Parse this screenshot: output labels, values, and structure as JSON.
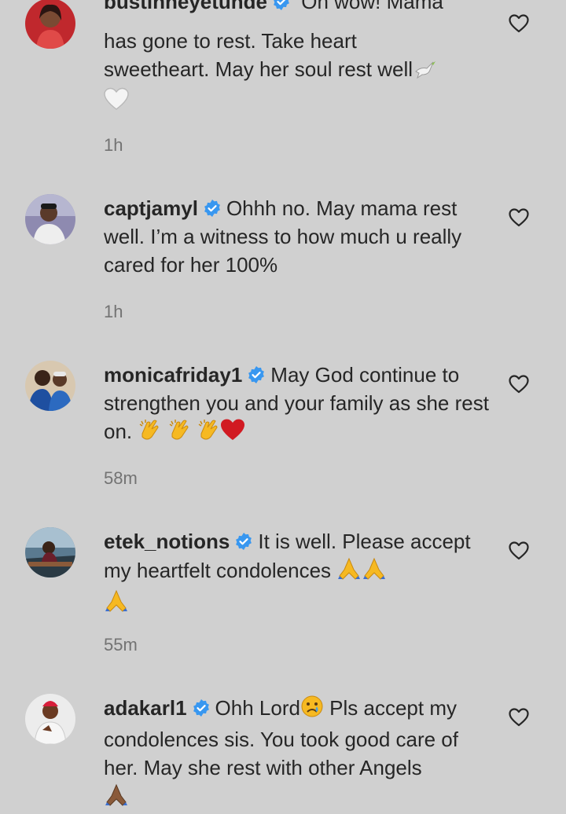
{
  "comments": [
    {
      "username": "bustinneyetunde",
      "text": "Oh wow! Mama has gone to rest. Take heart sweetheart. May her soul rest well",
      "emojis": [
        "dove",
        "white-heart"
      ],
      "time": "1h"
    },
    {
      "username": "captjamyl",
      "text": "Ohhh no. May mama rest well. I’m a witness to how much u really cared for her 100%",
      "emojis": [],
      "time": "1h"
    },
    {
      "username": "monicafriday1",
      "text": "May God continue to strengthen you and your family as she rest on.",
      "emojis": [
        "clapping-hands",
        "clapping-hands",
        "clapping-hands",
        "red-heart"
      ],
      "time": "58m"
    },
    {
      "username": "etek_notions",
      "text": "It is well. Please accept my heartfelt condolences",
      "emojis": [
        "folded-hands",
        "folded-hands",
        "folded-hands"
      ],
      "time": "55m"
    },
    {
      "username": "adakarl1",
      "text_before_emoji": "Ohh Lord",
      "text": "Pls accept my condolences sis. You took good care of her. May she rest with other Angels",
      "emojis": [
        "sad-face",
        "folded-hands-dark"
      ],
      "time": ""
    }
  ],
  "colors": {
    "background": "#d0d0d0",
    "text": "#262626",
    "timestamp": "#737373",
    "verified": "#3897f0"
  }
}
